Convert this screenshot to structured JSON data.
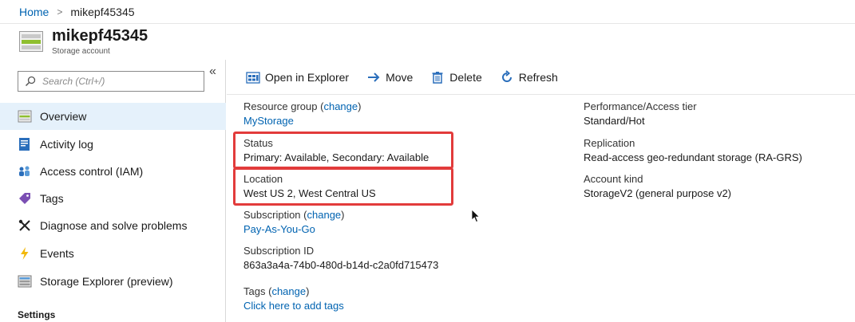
{
  "breadcrumb": {
    "home": "Home",
    "separator": ">",
    "current": "mikepf45345"
  },
  "header": {
    "title": "mikepf45345",
    "subtitle": "Storage account"
  },
  "sidebar": {
    "search_placeholder": "Search (Ctrl+/)",
    "collapse_glyph": "«",
    "items": [
      {
        "label": "Overview",
        "icon": "storage-overview-icon"
      },
      {
        "label": "Activity log",
        "icon": "activity-log-icon"
      },
      {
        "label": "Access control (IAM)",
        "icon": "people-icon"
      },
      {
        "label": "Tags",
        "icon": "tag-icon"
      },
      {
        "label": "Diagnose and solve problems",
        "icon": "wrench-icon"
      },
      {
        "label": "Events",
        "icon": "lightning-icon"
      },
      {
        "label": "Storage Explorer (preview)",
        "icon": "storage-explorer-icon"
      }
    ],
    "section_settings": "Settings"
  },
  "toolbar": {
    "open_explorer": "Open in Explorer",
    "move": "Move",
    "delete": "Delete",
    "refresh": "Refresh"
  },
  "essentials": {
    "resource_group_label": "Resource group",
    "change": "change",
    "resource_group_value": "MyStorage",
    "status_label": "Status",
    "status_value": "Primary: Available, Secondary: Available",
    "location_label": "Location",
    "location_value": "West US 2, West Central US",
    "subscription_label": "Subscription",
    "subscription_value": "Pay-As-You-Go",
    "subscription_id_label": "Subscription ID",
    "subscription_id_value": "863a3a4a-74b0-480d-b14d-c2a0fd715473",
    "tags_label": "Tags",
    "tags_value": "Click here to add tags",
    "perf_label": "Performance/Access tier",
    "perf_value": "Standard/Hot",
    "replication_label": "Replication",
    "replication_value": "Read-access geo-redundant storage (RA-GRS)",
    "account_kind_label": "Account kind",
    "account_kind_value": "StorageV2 (general purpose v2)"
  },
  "colors": {
    "link": "#0063b1",
    "highlight": "#e23b3b",
    "active_nav": "#e5f1fb"
  }
}
